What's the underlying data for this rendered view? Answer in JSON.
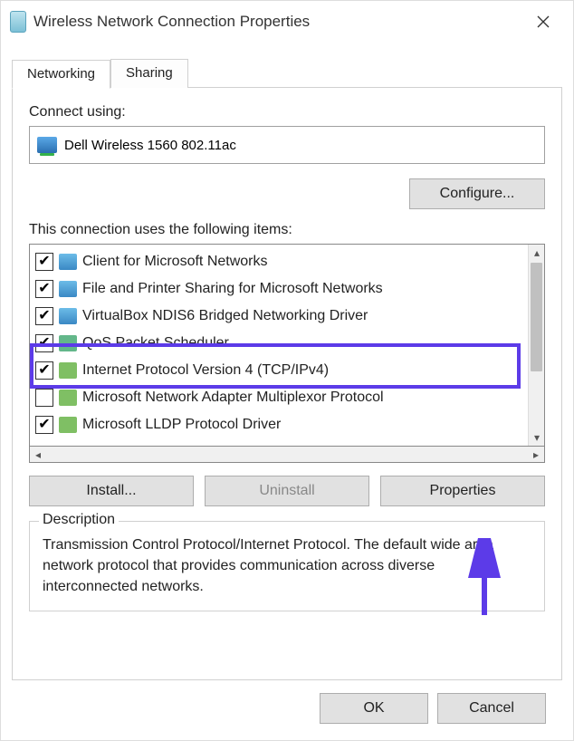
{
  "window": {
    "title": "Wireless Network Connection Properties"
  },
  "tabs": [
    {
      "label": "Networking",
      "active": true
    },
    {
      "label": "Sharing",
      "active": false
    }
  ],
  "connect_using_label": "Connect using:",
  "adapter": "Dell Wireless 1560 802.11ac",
  "configure_btn": "Configure...",
  "items_label": "This connection uses the following items:",
  "items": [
    {
      "checked": true,
      "icon": "svc",
      "name": "Client for Microsoft Networks"
    },
    {
      "checked": true,
      "icon": "svc",
      "name": "File and Printer Sharing for Microsoft Networks"
    },
    {
      "checked": true,
      "icon": "svc",
      "name": "VirtualBox NDIS6 Bridged Networking Driver"
    },
    {
      "checked": true,
      "icon": "grn2",
      "name": "QoS Packet Scheduler"
    },
    {
      "checked": true,
      "icon": "grn",
      "name": "Internet Protocol Version 4 (TCP/IPv4)",
      "highlighted": true
    },
    {
      "checked": false,
      "icon": "grn",
      "name": "Microsoft Network Adapter Multiplexor Protocol"
    },
    {
      "checked": true,
      "icon": "grn",
      "name": "Microsoft LLDP Protocol Driver"
    }
  ],
  "install_btn": "Install...",
  "uninstall_btn": "Uninstall",
  "properties_btn": "Properties",
  "description_legend": "Description",
  "description_text": "Transmission Control Protocol/Internet Protocol. The default wide area network protocol that provides communication across diverse interconnected networks.",
  "ok_btn": "OK",
  "cancel_btn": "Cancel",
  "annotation_color": "#5c3be8"
}
